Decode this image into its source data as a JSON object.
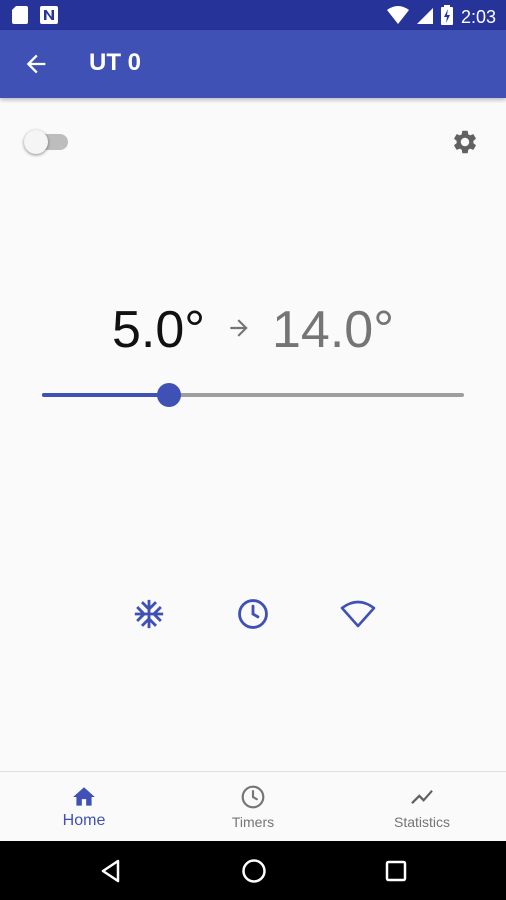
{
  "status_bar": {
    "time": "2:03",
    "icons": [
      "sd-card-icon",
      "n-notification-icon",
      "wifi-icon",
      "signal-icon",
      "battery-charging-icon"
    ]
  },
  "app_bar": {
    "title": "UT 0",
    "back_icon": "arrow-left-icon"
  },
  "controls": {
    "power_toggle_on": false,
    "settings_icon": "gear-icon"
  },
  "temperature": {
    "current": "5.0°",
    "target": "14.0°",
    "arrow_icon": "arrow-right-icon",
    "slider_value_fraction": 0.3
  },
  "modes": [
    {
      "name": "frost",
      "icon": "snowflake-icon"
    },
    {
      "name": "schedule",
      "icon": "clock-icon"
    },
    {
      "name": "wireless",
      "icon": "wifi-outline-icon"
    }
  ],
  "bottom_nav": {
    "items": [
      {
        "label": "Home",
        "icon": "home-icon",
        "active": true
      },
      {
        "label": "Timers",
        "icon": "clock-icon",
        "active": false
      },
      {
        "label": "Statistics",
        "icon": "chart-line-icon",
        "active": false
      }
    ]
  },
  "system_nav": [
    "back-triangle-icon",
    "home-circle-icon",
    "recents-square-icon"
  ],
  "colors": {
    "primary": "#3f51b5",
    "primary_dark": "#26349a",
    "inactive": "#757575",
    "background": "#fafafa"
  }
}
